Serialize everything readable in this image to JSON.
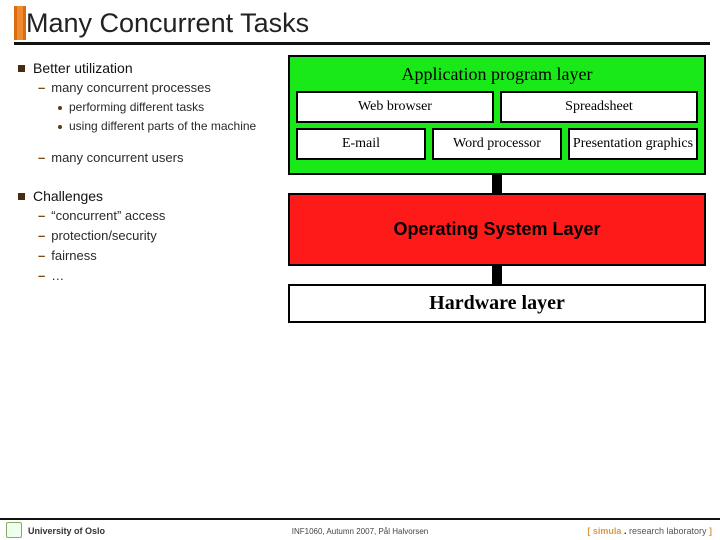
{
  "title": "Many Concurrent Tasks",
  "outline": {
    "item1": {
      "label": "Better utilization",
      "sub1": {
        "label": "many concurrent processes",
        "p1": "performing different tasks",
        "p2": "using different parts of the machine"
      },
      "sub2": {
        "label": "many concurrent users"
      }
    },
    "item2": {
      "label": "Challenges",
      "c1": "“concurrent” access",
      "c2": "protection/security",
      "c3": "fairness",
      "c4": "…"
    }
  },
  "diagram": {
    "app_layer_title": "Application program layer",
    "apps_row1": {
      "a1": "Web browser",
      "a2": "Spreadsheet"
    },
    "apps_row2": {
      "a1": "E-mail",
      "a2": "Word processor",
      "a3": "Presentation graphics"
    },
    "os_layer": "Operating System Layer",
    "hw_layer": "Hardware layer"
  },
  "footer": {
    "left": "University of Oslo",
    "center": "INF1060, Autumn 2007, Pål Halvorsen",
    "right_bracket_open": "[ ",
    "right_simula": "simula",
    "right_dot": " . ",
    "right_lab": "research laboratory",
    "right_bracket_close": " ]"
  }
}
